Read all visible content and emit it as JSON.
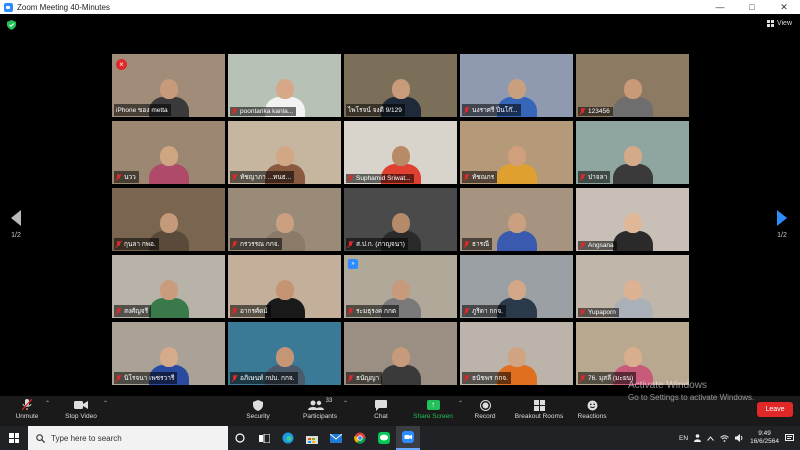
{
  "window": {
    "title": "Zoom Meeting 40-Minutes"
  },
  "view_button": {
    "label": "View",
    "icon": "grid-icon"
  },
  "pagination": {
    "left": "1/2",
    "right": "1/2"
  },
  "participants": [
    {
      "name": "iPhone ของ metta",
      "muted": false,
      "badge": "close",
      "bg": "#a08c78",
      "skin": "#c69a7a",
      "shirt": "#3a3a3a"
    },
    {
      "name": "poontarika kanla...",
      "muted": true,
      "bg": "#b8c1b5",
      "skin": "#d6a888",
      "shirt": "#f2f2f2"
    },
    {
      "name": "ไพโรจน์ จงดี 9/129",
      "muted": false,
      "active": true,
      "bg": "#7c6f5a",
      "skin": "#c89b7a",
      "shirt": "#1e2a3a"
    },
    {
      "name": "นงราศรี ปิ่นโก๊...",
      "muted": true,
      "bg": "#8f9ab0",
      "skin": "#c8a080",
      "shirt": "#3566b8"
    },
    {
      "name": "123456",
      "muted": true,
      "bg": "#8c7a62",
      "skin": "#c99a78",
      "shirt": "#6e6e6e"
    },
    {
      "name": "นวว",
      "muted": true,
      "bg": "#9c8872",
      "skin": "#d0a582",
      "shirt": "#b04a6a"
    },
    {
      "name": "ทัชญาภา ...ทนธ...",
      "muted": true,
      "bg": "#c6b6a0",
      "skin": "#d2a784",
      "shirt": "#8a5a40"
    },
    {
      "name": "Suphamid Sriwat...",
      "muted": true,
      "bg": "#d8d4cc",
      "skin": "#b98a66",
      "shirt": "#e04030"
    },
    {
      "name": "ทัชณกร",
      "muted": true,
      "bg": "#b59a7a",
      "skin": "#d0a07c",
      "shirt": "#e0a030"
    },
    {
      "name": "ปาจลา",
      "muted": true,
      "bg": "#8fa6a0",
      "skin": "#d4aa88",
      "shirt": "#3a3a3a"
    },
    {
      "name": "กุนลา กพอ.",
      "muted": true,
      "bg": "#7a6650",
      "skin": "#c49a7a",
      "shirt": "#5a4a3a"
    },
    {
      "name": "กรวรรณ กกจ.",
      "muted": true,
      "bg": "#9a8a78",
      "skin": "#caa080",
      "shirt": "#8a7a68"
    },
    {
      "name": "ส.ป.ก. (ภาญจนา)",
      "muted": true,
      "bg": "#4a4a4a",
      "skin": "#b48a6a",
      "shirt": "#2a2a2a"
    },
    {
      "name": "ธารณี",
      "muted": true,
      "bg": "#a69480",
      "skin": "#caa080",
      "shirt": "#3a5ab0"
    },
    {
      "name": "Angsana",
      "muted": true,
      "bg": "#c8c0b6",
      "skin": "#e0b898",
      "shirt": "#2a2a2a"
    },
    {
      "name": "สงศัญจรี",
      "muted": true,
      "bg": "#b8b2a8",
      "skin": "#c89c7c",
      "shirt": "#3a7a4a"
    },
    {
      "name": "อากรศ์ดม์",
      "muted": true,
      "bg": "#c4b09a",
      "skin": "#c49474",
      "shirt": "#1a1a1a"
    },
    {
      "name": "ระมธุรงค กกต",
      "muted": true,
      "badge": "forward",
      "bg": "#b0a898",
      "skin": "#c69a7a",
      "shirt": "#7a7a7a"
    },
    {
      "name": "ภูริดา กกจ.",
      "muted": true,
      "bg": "#9aa0a4",
      "skin": "#d2a888",
      "shirt": "#2a3a4a"
    },
    {
      "name": "Yupaporn",
      "muted": true,
      "bg": "#c0b6aa",
      "skin": "#ddb292",
      "shirt": "#aab0b8"
    },
    {
      "name": "นิโรจนา เพชรวารี",
      "muted": true,
      "bg": "#aaa296",
      "skin": "#d6ab8a",
      "shirt": "#2a4aa0"
    },
    {
      "name": "อภิเษนท์ กปบ. กกจ.",
      "muted": true,
      "bg": "#3a7a96",
      "skin": "#c49676",
      "shirt": "#4a5a6a"
    },
    {
      "name": "ธนัญญา",
      "muted": true,
      "bg": "#9a8f82",
      "skin": "#c69a7a",
      "shirt": "#3a3a3a"
    },
    {
      "name": "ธนัชพร กกจ.",
      "muted": true,
      "bg": "#bcb4aa",
      "skin": "#d0a482",
      "shirt": "#e07020"
    },
    {
      "name": "76. มุสลี (มะยน)",
      "muted": true,
      "bg": "#b8a890",
      "skin": "#d8ae8c",
      "shirt": "#c85a7a"
    }
  ],
  "toolbar": {
    "unmute": "Unmute",
    "stop_video": "Stop Video",
    "security": "Security",
    "participants": "Participants",
    "participants_count": "33",
    "chat": "Chat",
    "share_screen": "Share Screen",
    "record": "Record",
    "breakout_rooms": "Breakout Rooms",
    "reactions": "Reactions",
    "leave": "Leave"
  },
  "watermark": {
    "title": "Activate Windows",
    "subtitle": "Go to Settings to activate Windows."
  },
  "taskbar": {
    "search_placeholder": "Type here to search",
    "language": "EN",
    "time": "9:49",
    "date": "16/6/2564"
  },
  "colors": {
    "accent": "#2d8cff",
    "leave": "#e02828",
    "share": "#22c05a",
    "active_border": "#b6e33c"
  }
}
